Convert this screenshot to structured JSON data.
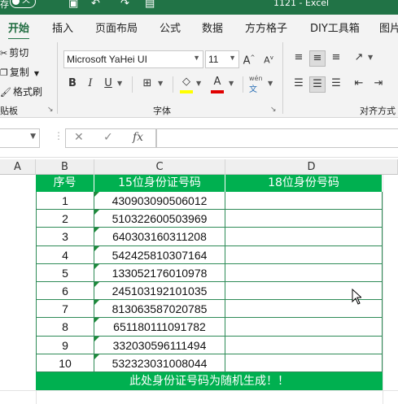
{
  "title": {
    "left_char": "存",
    "toggle_text": "关",
    "center": "1121  -  Excel"
  },
  "tabs": [
    "开始",
    "插入",
    "页面布局",
    "公式",
    "数据",
    "方方格子",
    "DIY工具箱",
    "图片"
  ],
  "clipboard": {
    "cut": "剪切",
    "copy": "复制",
    "painter": "格式刷",
    "group": "贴板"
  },
  "font": {
    "name": "Microsoft YaHei UI",
    "size": "11",
    "grow": "A",
    "shrink": "A",
    "bold": "B",
    "italic": "I",
    "underline": "U",
    "color_a": "A",
    "wen": "wén",
    "wen_char": "文",
    "group": "字体"
  },
  "align": {
    "group": "对齐方式"
  },
  "formula": {
    "fx": "fx",
    "cancel": "✕",
    "confirm": "✓",
    "value": ""
  },
  "columns": {
    "a": "A",
    "b": "B",
    "c": "C",
    "d": "D"
  },
  "table": {
    "headers": [
      "序号",
      "15位身份证号码",
      "18位身份号码"
    ],
    "rows": [
      {
        "n": "1",
        "id15": "430903090506012",
        "id18": ""
      },
      {
        "n": "2",
        "id15": "510322600503969",
        "id18": ""
      },
      {
        "n": "3",
        "id15": "640303160311208",
        "id18": ""
      },
      {
        "n": "4",
        "id15": "542425810307164",
        "id18": ""
      },
      {
        "n": "5",
        "id15": "133052176010978",
        "id18": ""
      },
      {
        "n": "6",
        "id15": "245103192101035",
        "id18": ""
      },
      {
        "n": "7",
        "id15": "813063587020785",
        "id18": ""
      },
      {
        "n": "8",
        "id15": "651180111091782",
        "id18": ""
      },
      {
        "n": "9",
        "id15": "332030596111494",
        "id18": ""
      },
      {
        "n": "10",
        "id15": "532323031008044",
        "id18": ""
      }
    ],
    "footer": "此处身份证号码为随机生成！！"
  },
  "colors": {
    "excel_green": "#217346",
    "header_fill": "#00b050",
    "font_color_bar": "#e00000",
    "highlight_bar": "#ffff00"
  }
}
